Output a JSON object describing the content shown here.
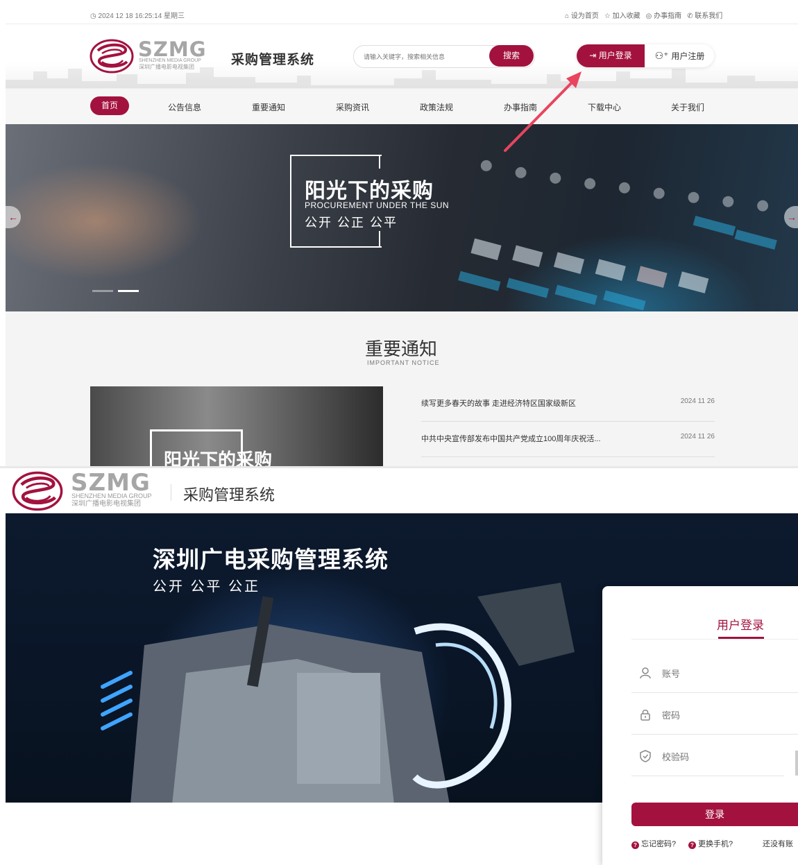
{
  "colors": {
    "accent": "#a3123f",
    "arrow": "#e8455e"
  },
  "topbar": {
    "datetime": "2024 12 18 16:25:14 星期三",
    "links": [
      "设为首页",
      "加入收藏",
      "办事指南",
      "联系我们"
    ]
  },
  "logo": {
    "brand": "SZMG",
    "en": "SHENZHEN MEDIA GROUP",
    "cn": "深圳广播电影电视集团"
  },
  "header": {
    "system_title": "采购管理系统",
    "search_placeholder": "请输入关键字，搜索相关信息",
    "search_button": "搜索",
    "login_button": "用户登录",
    "register_button": "用户注册"
  },
  "nav": {
    "items": [
      "首页",
      "公告信息",
      "重要通知",
      "采购资讯",
      "政策法规",
      "办事指南",
      "下载中心",
      "关于我们"
    ]
  },
  "banner": {
    "title": "阳光下的采购",
    "subtitle_en": "PROCUREMENT UNDER THE SUN",
    "subtitle_cn": "公开  公正  公平",
    "active_slide": 2,
    "slide_count": 2
  },
  "notices": {
    "title": "重要通知",
    "subtitle": "IMPORTANT NOTICE",
    "image_caption": "阳光下的采购",
    "items": [
      {
        "text": "续写更多春天的故事 走进经济特区国家级新区",
        "date": "2024 11 26"
      },
      {
        "text": "中共中央宣传部发布中国共产党成立100周年庆祝活...",
        "date": "2024 11 26"
      }
    ]
  },
  "login_page": {
    "system_title": "采购管理系统",
    "hero_title": "深圳广电采购管理系统",
    "hero_subtitle": "公开  公平  公正",
    "tab": "用户登录",
    "account_placeholder": "账号",
    "password_placeholder": "密码",
    "captcha_placeholder": "校验码",
    "login_button": "登录",
    "forgot_password": "忘记密码?",
    "change_phone": "更换手机?",
    "no_account": "还没有账"
  }
}
